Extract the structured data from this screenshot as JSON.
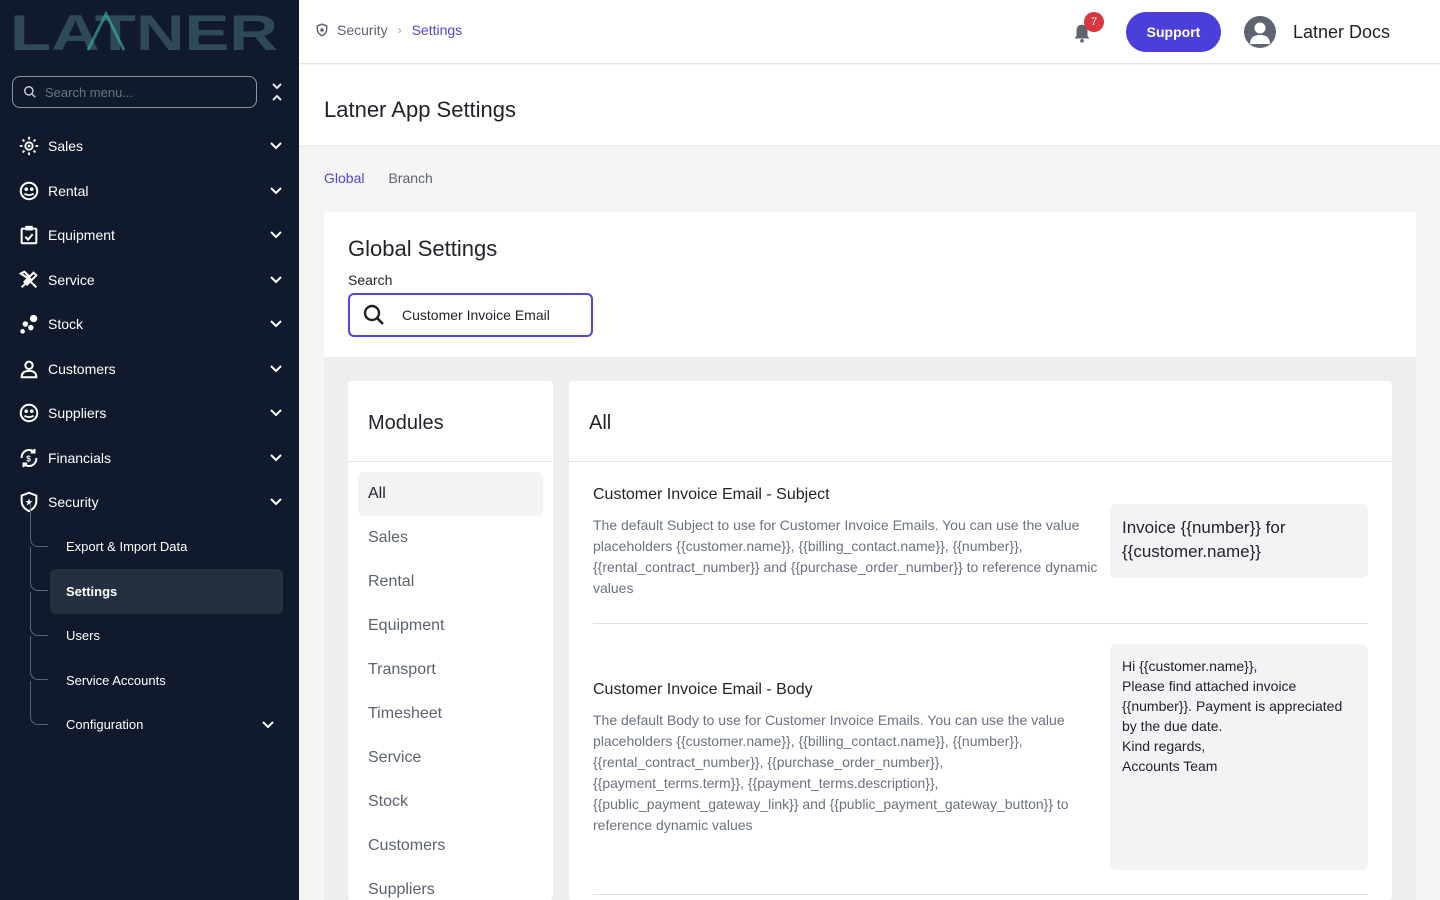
{
  "brand": {
    "logo_text": "LATNER",
    "logo_color": "#2e4a56",
    "logo_accent": "#3fb8a4"
  },
  "sidebar": {
    "search_placeholder": "Search menu...",
    "items": [
      {
        "label": "Sales",
        "icon": "sales-icon"
      },
      {
        "label": "Rental",
        "icon": "rental-icon"
      },
      {
        "label": "Equipment",
        "icon": "equipment-icon"
      },
      {
        "label": "Service",
        "icon": "service-icon"
      },
      {
        "label": "Stock",
        "icon": "stock-icon"
      },
      {
        "label": "Customers",
        "icon": "customers-icon"
      },
      {
        "label": "Suppliers",
        "icon": "suppliers-icon"
      },
      {
        "label": "Financials",
        "icon": "financials-icon"
      },
      {
        "label": "Security",
        "icon": "security-icon"
      }
    ],
    "security_sub": [
      {
        "label": "Export & Import Data"
      },
      {
        "label": "Settings",
        "active": true
      },
      {
        "label": "Users"
      },
      {
        "label": "Service Accounts"
      },
      {
        "label": "Configuration"
      }
    ]
  },
  "header": {
    "breadcrumb": [
      "Security",
      "Settings"
    ],
    "notification_count": "7",
    "support_label": "Support",
    "user_name": "Latner Docs"
  },
  "page": {
    "title": "Latner App Settings"
  },
  "tabs": [
    {
      "label": "Global",
      "active": true
    },
    {
      "label": "Branch"
    }
  ],
  "global_settings": {
    "title": "Global Settings",
    "search_label": "Search",
    "search_value": "Customer Invoice Email"
  },
  "modules": {
    "title": "Modules",
    "items": [
      "All",
      "Sales",
      "Rental",
      "Equipment",
      "Transport",
      "Timesheet",
      "Service",
      "Stock",
      "Customers",
      "Suppliers"
    ],
    "selected": "All"
  },
  "settings_panel": {
    "title": "All",
    "settings": [
      {
        "name": "Customer Invoice Email - Subject",
        "description": "The default Subject to use for Customer Invoice Emails. You can use the value placeholders {{customer.name}}, {{billing_contact.name}}, {{number}}, {{rental_contract_number}} and {{purchase_order_number}} to reference dynamic values",
        "value": "Invoice {{number}} for {{customer.name}}"
      },
      {
        "name": "Customer Invoice Email - Body",
        "description": "The default Body to use for Customer Invoice Emails. You can use the value placeholders {{customer.name}}, {{billing_contact.name}}, {{number}}, {{rental_contract_number}}, {{purchase_order_number}}, {{payment_terms.term}}, {{payment_terms.description}}, {{public_payment_gateway_link}} and {{public_payment_gateway_button}} to reference dynamic values",
        "value": "Hi {{customer.name}},\nPlease find attached invoice {{number}}. Payment is appreciated by the due date.\nKind regards,\nAccounts Team"
      }
    ]
  },
  "colors": {
    "sidebar_bg": "#101a2c",
    "accent": "#4f46e5",
    "support_button": "#4b3fd9",
    "badge": "#d9363e"
  }
}
